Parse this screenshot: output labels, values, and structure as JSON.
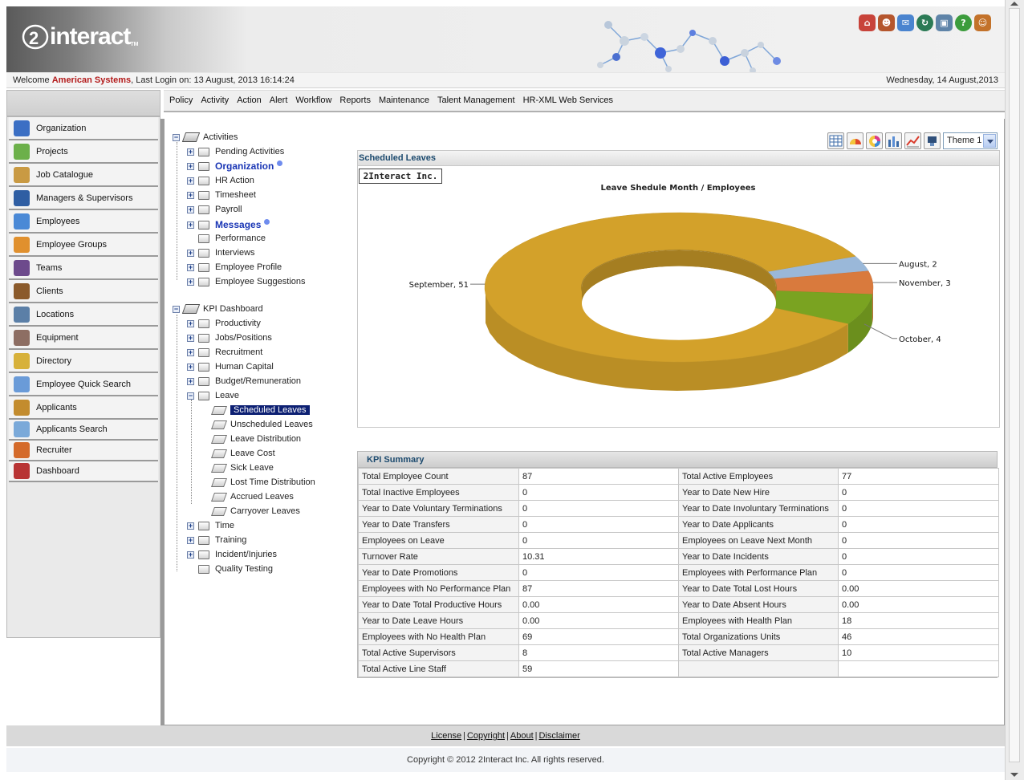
{
  "header": {
    "logo_text": "interact",
    "logo_tm": "TM",
    "icons": [
      "home-icon",
      "user-icon",
      "mail-icon",
      "sync-icon",
      "computer-icon",
      "help-icon",
      "logout-user-icon"
    ]
  },
  "welcome": {
    "prefix": "Welcome",
    "company": "American Systems",
    "last_login": ", Last Login on: 13 August, 2013 16:14:24",
    "date": "Wednesday, 14 August,2013"
  },
  "top_menu": [
    "Policy",
    "Activity",
    "Action",
    "Alert",
    "Workflow",
    "Reports",
    "Maintenance",
    "Talent Management",
    "HR-XML Web Services"
  ],
  "sidebar": {
    "items": [
      {
        "label": "Organization",
        "icon": "organization-icon",
        "color": "#3b6fc4"
      },
      {
        "label": "Projects",
        "icon": "projects-icon",
        "color": "#6cb04a"
      },
      {
        "label": "Job Catalogue",
        "icon": "job-catalogue-icon",
        "color": "#c99a43"
      },
      {
        "label": "Managers & Supervisors",
        "icon": "managers-icon",
        "color": "#2f5ea3"
      },
      {
        "label": "Employees",
        "icon": "employees-icon",
        "color": "#4a89d6"
      },
      {
        "label": "Employee Groups",
        "icon": "employee-groups-icon",
        "color": "#e0902e"
      },
      {
        "label": "Teams",
        "icon": "teams-icon",
        "color": "#6d4a8c"
      },
      {
        "label": "Clients",
        "icon": "clients-icon",
        "color": "#8b5a2b"
      },
      {
        "label": "Locations",
        "icon": "locations-icon",
        "color": "#5b7fa7"
      },
      {
        "label": "Equipment",
        "icon": "equipment-icon",
        "color": "#8d6e63"
      },
      {
        "label": "Directory",
        "icon": "directory-icon",
        "color": "#d7b13a"
      },
      {
        "label": "Employee Quick Search",
        "icon": "quick-search-icon",
        "color": "#6a9bd8"
      },
      {
        "label": "Applicants",
        "icon": "applicants-icon",
        "color": "#c38c2e"
      },
      {
        "label": "Applicants Search",
        "icon": "applicants-search-icon",
        "color": "#7aa9d9"
      },
      {
        "label": "Recruiter",
        "icon": "recruiter-icon",
        "color": "#d46a2a"
      },
      {
        "label": "Dashboard",
        "icon": "dashboard-icon",
        "color": "#b83434"
      }
    ]
  },
  "tree": {
    "activities": {
      "root": "Activities",
      "items": [
        "Pending Activities",
        "Organization",
        "HR Action",
        "Timesheet",
        "Payroll",
        "Messages",
        "Performance",
        "Interviews",
        "Employee Profile",
        "Employee Suggestions"
      ]
    },
    "kpi": {
      "root": "KPI Dashboard",
      "items": [
        "Productivity",
        "Jobs/Positions",
        "Recruitment",
        "Human Capital",
        "Budget/Remuneration",
        "Leave"
      ],
      "leave_children": [
        "Scheduled Leaves",
        "Unscheduled Leaves",
        "Leave Distribution",
        "Leave Cost",
        "Sick Leave",
        "Lost Time Distribution",
        "Accrued Leaves",
        "Carryover Leaves"
      ],
      "after": [
        "Time",
        "Training",
        "Incident/Injuries",
        "Quality Testing"
      ]
    }
  },
  "chart_toolbar": {
    "tools": [
      "table-view-icon",
      "gauge-chart-icon",
      "pie-chart-icon",
      "bar-chart-icon",
      "line-chart-icon",
      "export-icon"
    ],
    "theme": "Theme 1"
  },
  "scheduled_leaves": {
    "title": "Scheduled Leaves",
    "brand": "2Interact Inc."
  },
  "chart_data": {
    "type": "pie",
    "title": "Leave Shedule Month / Employees",
    "labels": [
      "September",
      "August",
      "November",
      "October"
    ],
    "values": [
      51,
      2,
      3,
      4
    ],
    "colors": [
      "#d3a12a",
      "#9ab8d9",
      "#d97a3d",
      "#7aa321"
    ],
    "label_format": "{label}, {value}",
    "style": "3d-donut"
  },
  "kpi_summary": {
    "title": "KPI Summary",
    "rows": [
      [
        "Total Employee Count",
        "87",
        "Total Active Employees",
        "77"
      ],
      [
        "Total Inactive Employees",
        "0",
        "Year to Date New Hire",
        "0"
      ],
      [
        "Year to Date Voluntary Terminations",
        "0",
        "Year to Date Involuntary Terminations",
        "0"
      ],
      [
        "Year to Date Transfers",
        "0",
        "Year to Date Applicants",
        "0"
      ],
      [
        "Employees on Leave",
        "0",
        "Employees on Leave Next Month",
        "0"
      ],
      [
        "Turnover Rate",
        "10.31",
        "Year to Date Incidents",
        "0"
      ],
      [
        "Year to Date Promotions",
        "0",
        "Employees with Performance Plan",
        "0"
      ],
      [
        "Employees with No Performance Plan",
        "87",
        "Year to Date Total Lost Hours",
        "0.00"
      ],
      [
        "Year to Date Total Productive Hours",
        "0.00",
        "Year to Date Absent Hours",
        "0.00"
      ],
      [
        "Year to Date Leave Hours",
        "0.00",
        "Employees with Health Plan",
        "18"
      ],
      [
        "Employees with No Health Plan",
        "69",
        "Total Organizations Units",
        "46"
      ],
      [
        "Total Active Supervisors",
        "8",
        "Total Active Managers",
        "10"
      ],
      [
        "Total Active Line Staff",
        "59",
        "",
        ""
      ]
    ]
  },
  "footer": {
    "links": [
      "License",
      "Copyright",
      "About",
      "Disclaimer"
    ],
    "separator": "|",
    "copyright": "Copyright © 2012 2Interact Inc. All rights reserved."
  }
}
